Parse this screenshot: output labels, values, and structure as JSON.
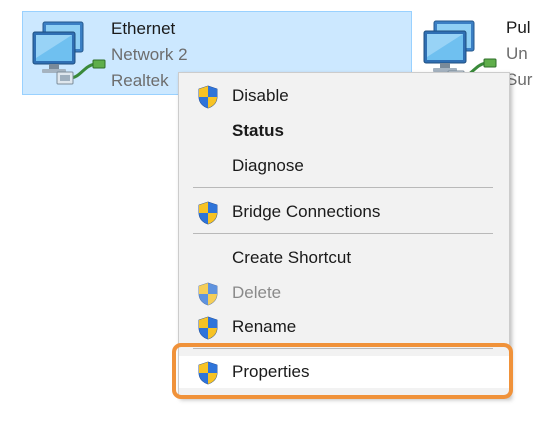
{
  "adapters": [
    {
      "name": "Ethernet",
      "network": "Network 2",
      "device": "Realtek",
      "selected": true,
      "icon": "network-adapter-icon"
    },
    {
      "name": "Pul",
      "network": "Un",
      "device": "Sur",
      "selected": false,
      "icon": "network-adapter-icon"
    }
  ],
  "context_menu": {
    "items": [
      {
        "label": "Disable",
        "icon": "uac-shield-icon",
        "state": "normal"
      },
      {
        "label": "Status",
        "icon": null,
        "state": "default-bold"
      },
      {
        "label": "Diagnose",
        "icon": null,
        "state": "normal"
      },
      {
        "label": "Bridge Connections",
        "icon": "uac-shield-icon",
        "state": "normal"
      },
      {
        "label": "Create Shortcut",
        "icon": null,
        "state": "normal"
      },
      {
        "label": "Delete",
        "icon": "uac-shield-icon",
        "state": "disabled"
      },
      {
        "label": "Rename",
        "icon": "uac-shield-icon",
        "state": "normal"
      },
      {
        "label": "Properties",
        "icon": "uac-shield-icon",
        "state": "highlighted"
      }
    ]
  },
  "colors": {
    "selection_bg": "#cce8ff",
    "selection_border": "#99d1ff",
    "menu_bg": "#f2f2f2",
    "highlight_outline": "#f0923a",
    "shield_blue": "#1f5fbf",
    "shield_yellow": "#f7c325"
  }
}
